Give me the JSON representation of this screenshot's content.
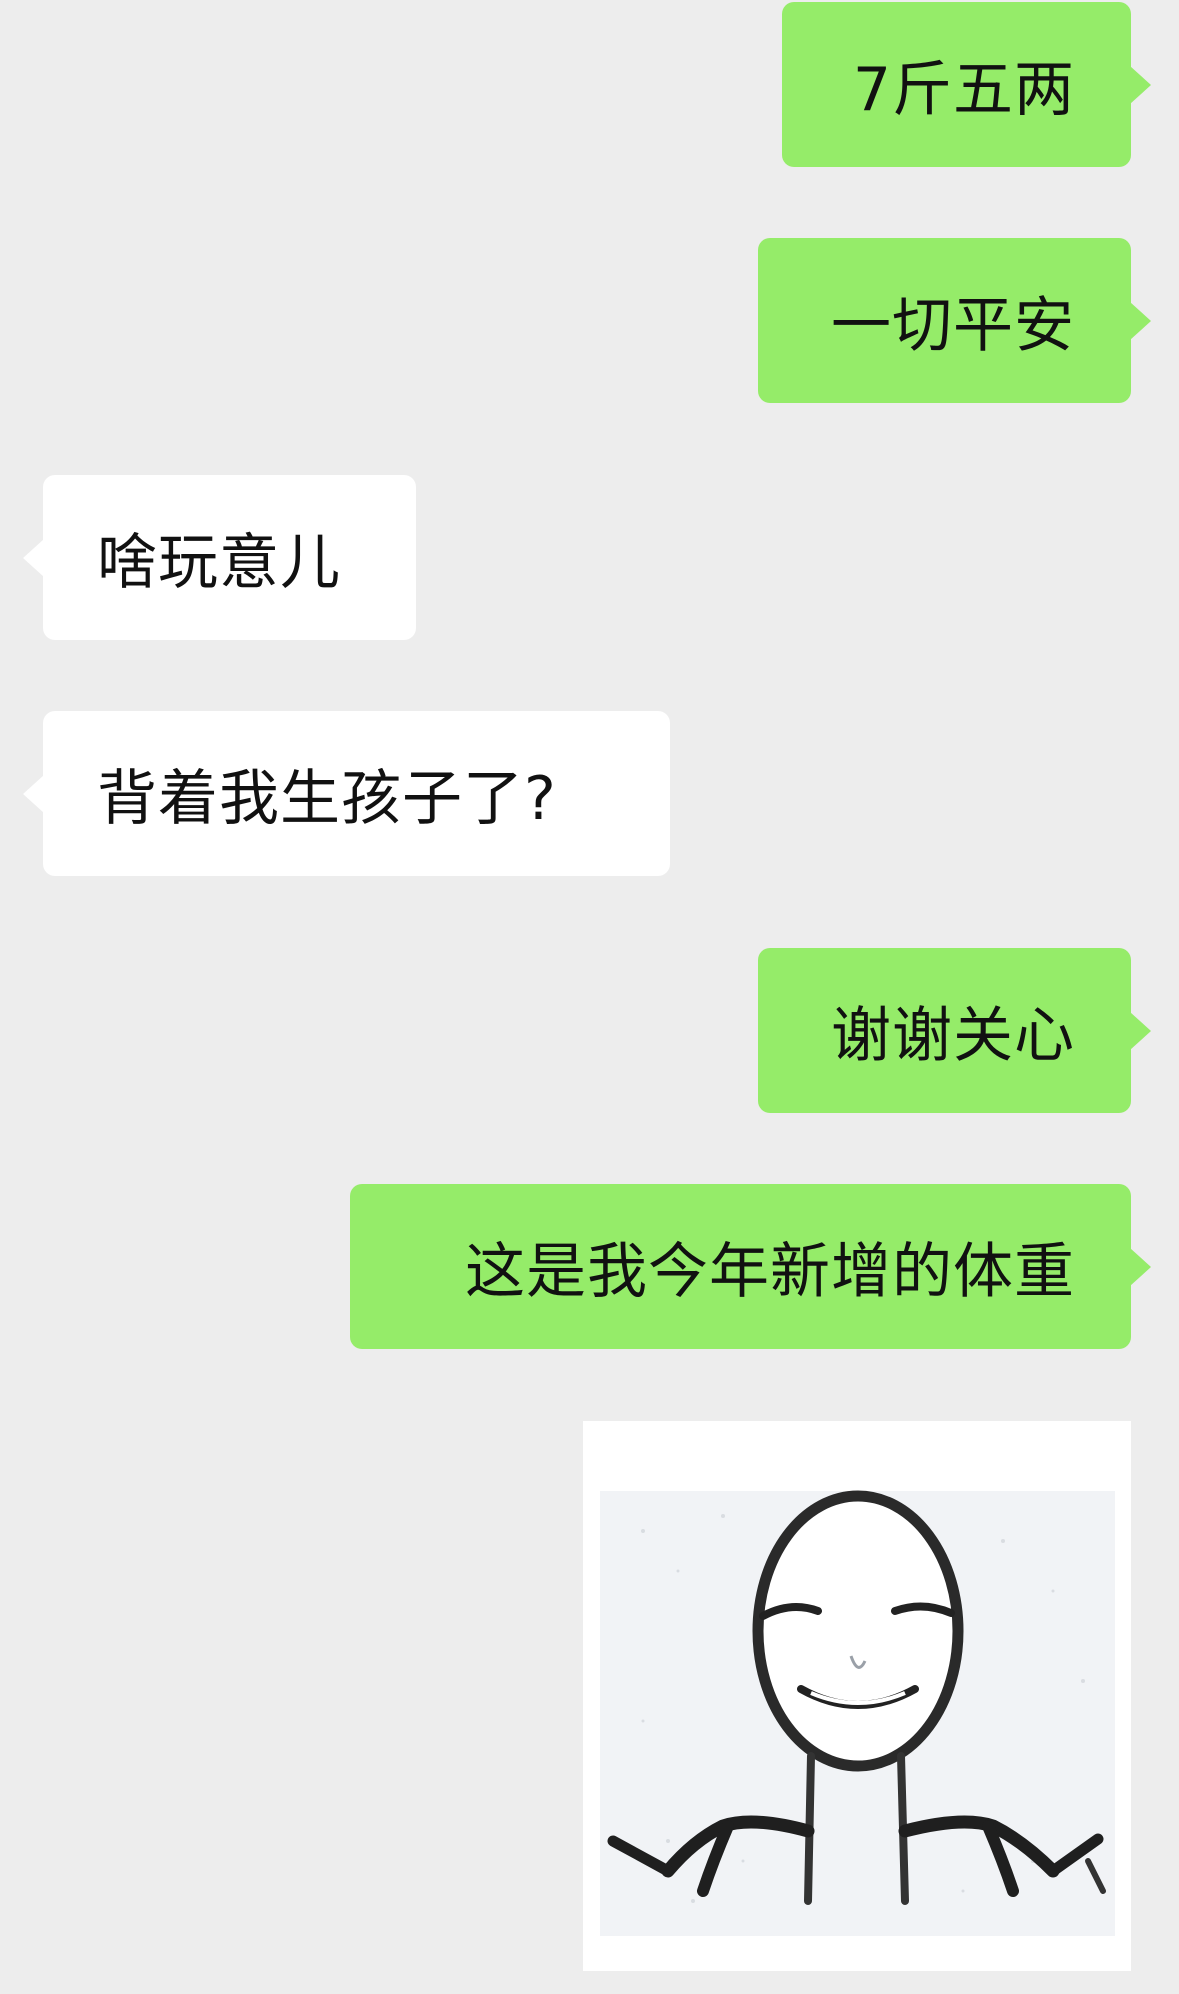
{
  "chat": {
    "messages": [
      {
        "side": "outgoing",
        "text": "7斤五两"
      },
      {
        "side": "outgoing",
        "text": "一切平安"
      },
      {
        "side": "incoming",
        "text": "啥玩意儿"
      },
      {
        "side": "incoming",
        "text": "背着我生孩子了?"
      },
      {
        "side": "outgoing",
        "text": "谢谢关心"
      },
      {
        "side": "outgoing",
        "text": "这是我今年新增的体重"
      }
    ],
    "sticker": {
      "side": "outgoing",
      "icon": "shrug-meme-face-sticker"
    }
  },
  "colors": {
    "background": "#ededed",
    "outgoing_bubble": "#95ec69",
    "incoming_bubble": "#ffffff",
    "text": "#111111"
  }
}
